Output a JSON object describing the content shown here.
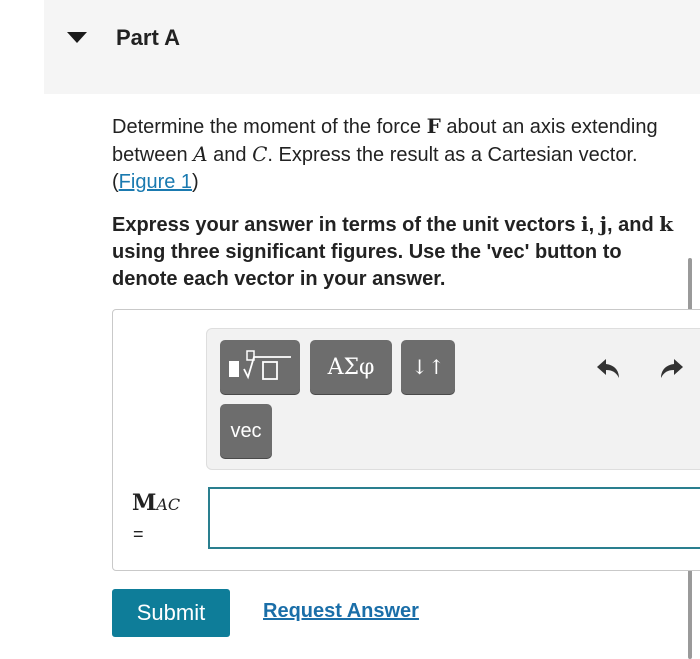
{
  "part": {
    "title": "Part A"
  },
  "prompt": {
    "text_1": "Determine the moment of the force ",
    "force_symbol": "F",
    "text_2": " about an axis extending between ",
    "point_a": "A",
    "text_3": " and ",
    "point_c": "C",
    "text_4": ". Express the result as a Cartesian vector. (",
    "figure_link": "Figure 1",
    "text_5": ")"
  },
  "instructions": {
    "text_1": "Express your answer in terms of the unit vectors ",
    "unit_i": "i",
    "comma_1": ", ",
    "unit_j": "j",
    "text_2": ", and ",
    "unit_k": "k",
    "text_3": " using three significant figures. Use the 'vec' button to denote each vector in your answer."
  },
  "toolbar": {
    "templates_icon": "templates-radical-icon",
    "greek_label": "ΑΣφ",
    "updown_label": "↓↑",
    "vec_label": "vec",
    "undo_icon": "undo-arrow-icon",
    "redo_icon": "redo-arrow-icon"
  },
  "answer": {
    "variable": "M",
    "subscript": "AC",
    "equals": "=",
    "value": "",
    "border_color": "#2a7f8f"
  },
  "actions": {
    "submit_label": "Submit",
    "request_label": "Request Answer",
    "submit_color": "#0e7d99"
  }
}
